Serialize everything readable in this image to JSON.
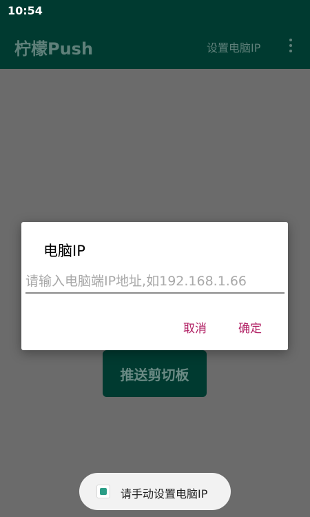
{
  "status_bar": {
    "time": "10:54"
  },
  "app_bar": {
    "title": "柠檬Push",
    "action_label": "设置电脑IP",
    "overflow_icon": "more-vert-icon"
  },
  "main": {
    "push_button_label": "推送剪切板"
  },
  "dialog": {
    "title": "电脑IP",
    "input_value": "",
    "input_placeholder": "请输入电脑端IP地址,如192.168.1.66",
    "cancel_label": "取消",
    "confirm_label": "确定",
    "accent_color": "#b11f63"
  },
  "toast": {
    "icon": "app-icon",
    "text": "请手动设置电脑IP"
  },
  "colors": {
    "primary_dark": "#003a30",
    "scrim": "#6b6b6b"
  }
}
